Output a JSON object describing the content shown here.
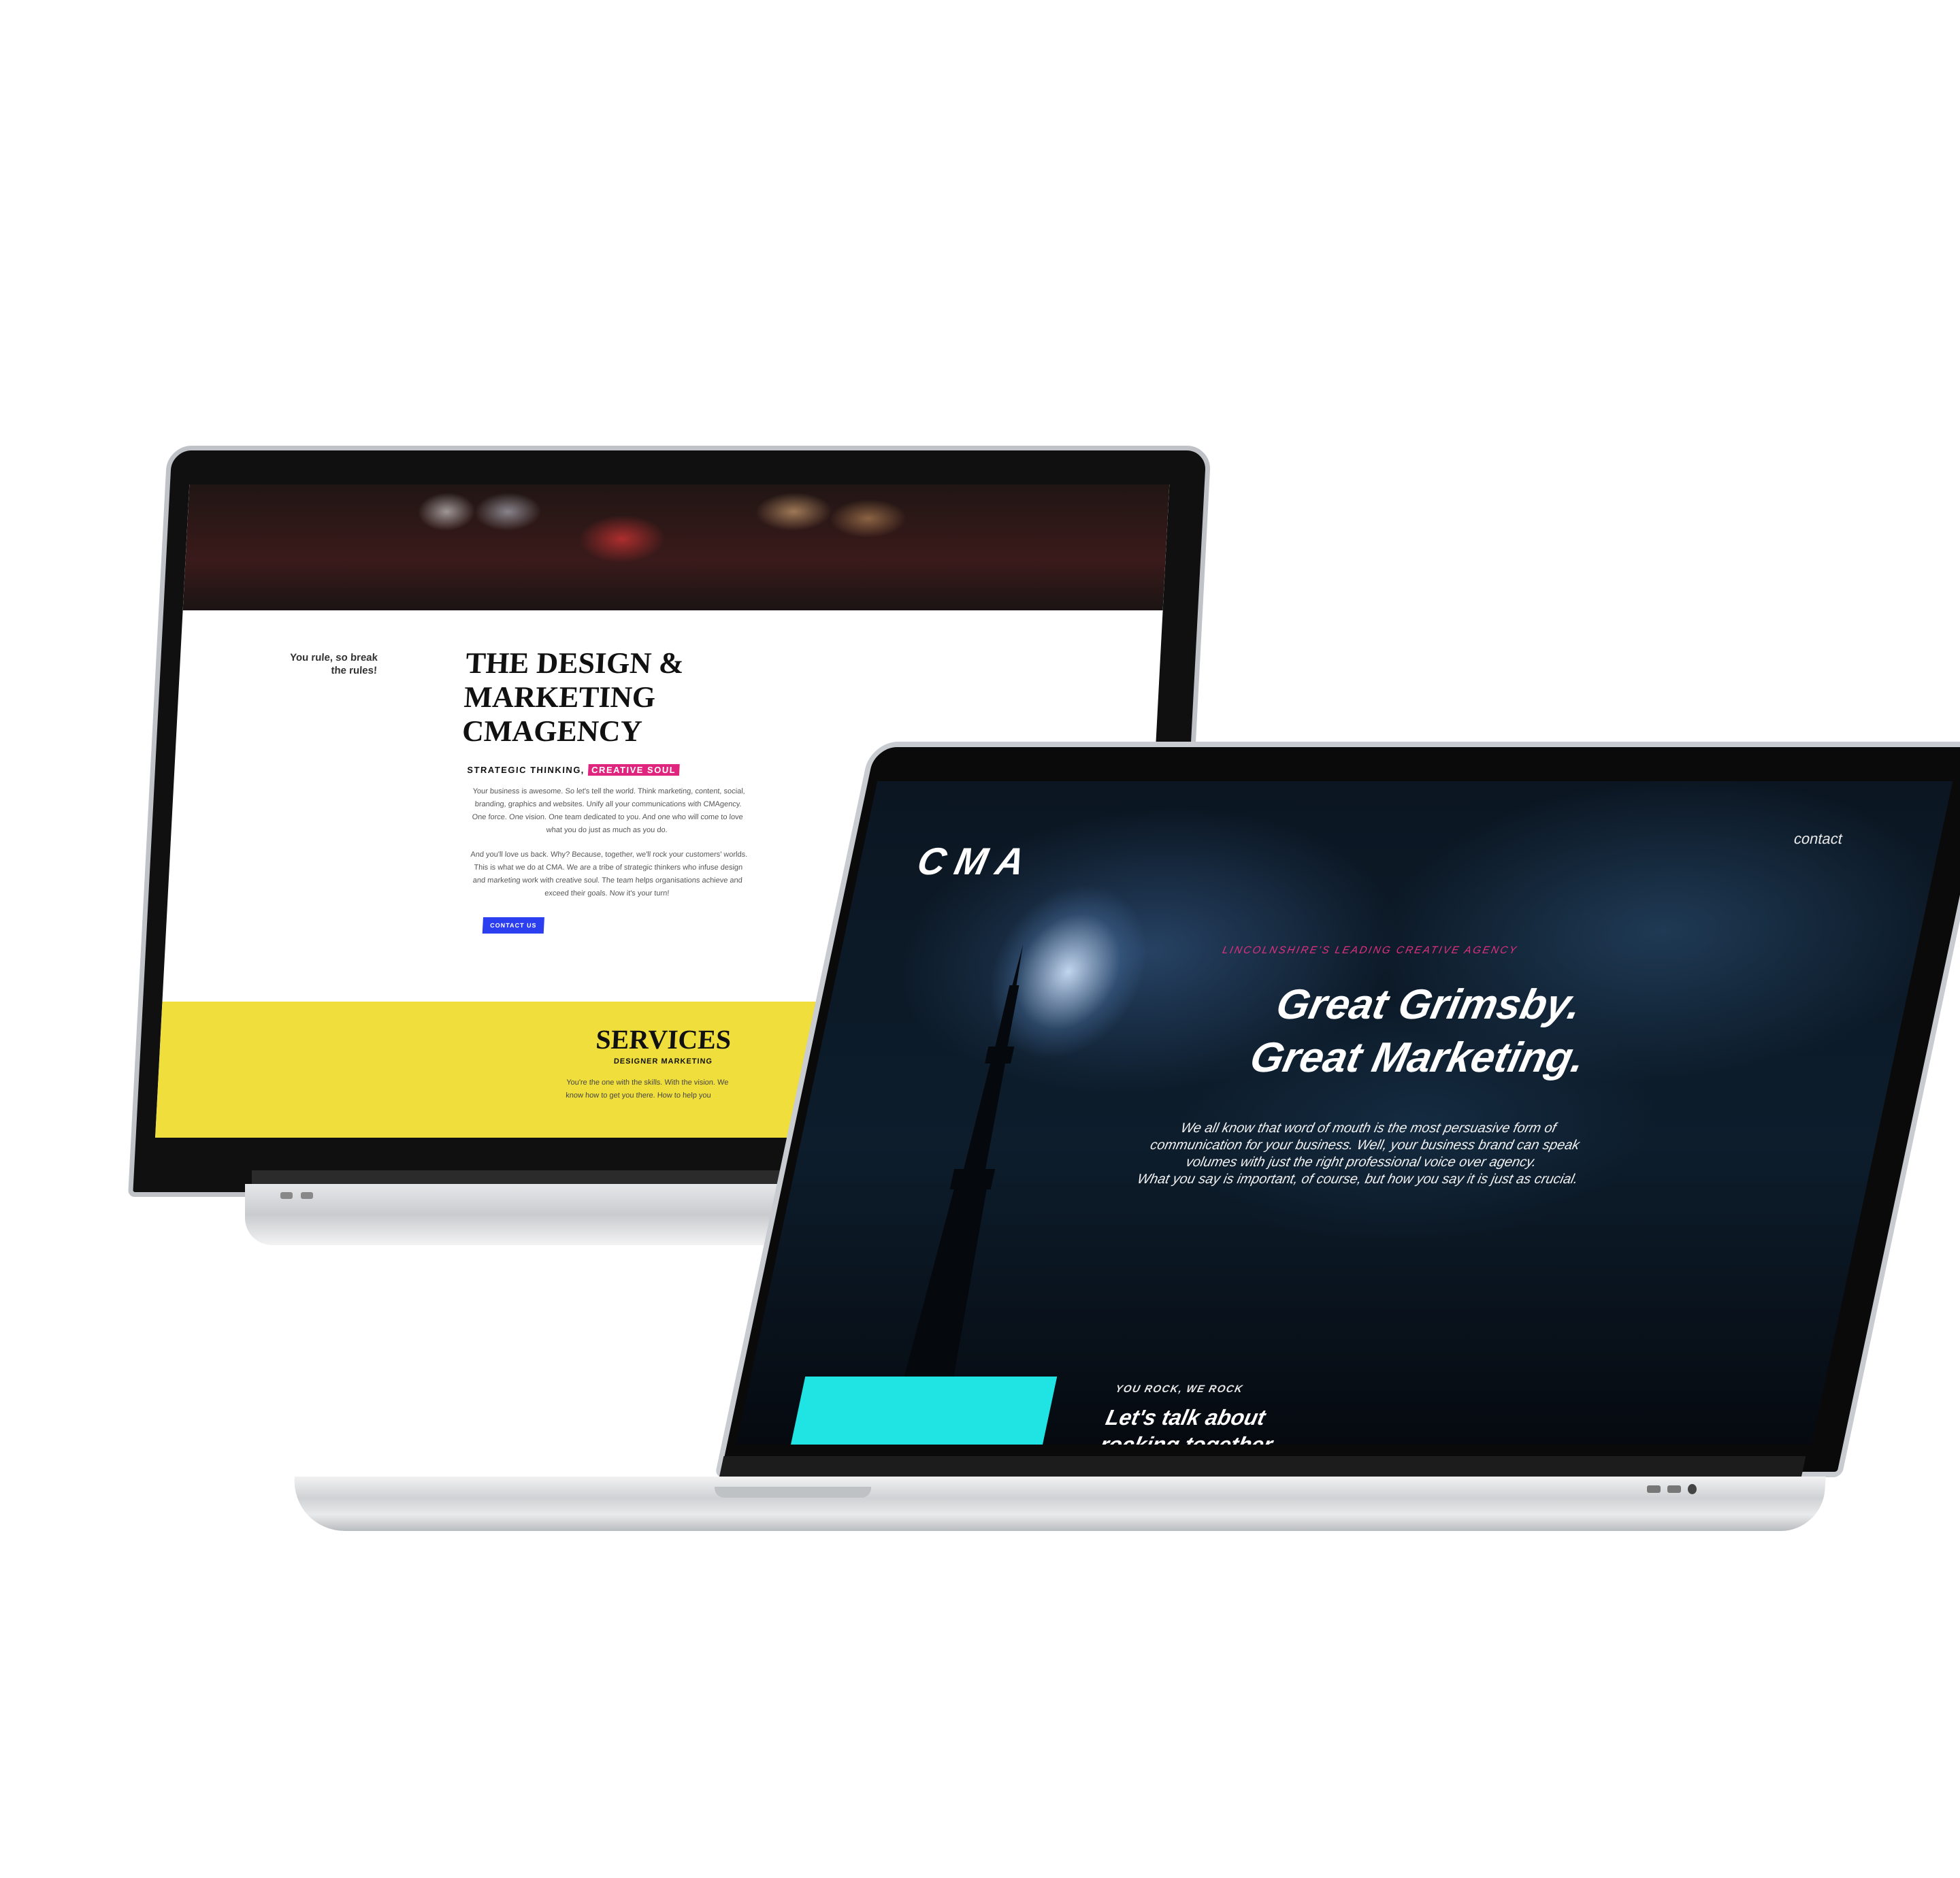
{
  "back_site": {
    "tagline": "You rule, so break the rules!",
    "headline": "The Design & Marketing CMAgency",
    "strategic_prefix": "STRATEGIC THINKING,",
    "strategic_highlight": "CREATIVE SOUL",
    "paragraph_1": "Your business is awesome. So let's tell the world. Think marketing, content, social, branding, graphics and websites. Unify all your communications with CMAgency. One force. One vision. One team dedicated to you. And one who will come to love what you do just as much as you do.",
    "paragraph_2": "And you'll love us back. Why? Because, together, we'll rock your customers' worlds. This is what we do at CMA. We are a tribe of strategic thinkers who infuse design and marketing work with creative soul. The team helps organisations achieve and exceed their goals. Now it's your turn!",
    "contact_button": "CONTACT US",
    "services_title": "SERVICES",
    "services_subtitle": "DESIGNER MARKETING",
    "services_text": "You're the one with the skills. With the vision. We know how to get you there. How to help you"
  },
  "front_site": {
    "logo": "CMA",
    "nav_contact": "contact",
    "eyebrow": "LINCOLNSHIRE'S LEADING CREATIVE AGENCY",
    "headline_line1": "Great Grimsby.",
    "headline_line2": "Great Marketing.",
    "body_line1": "We all know that word of mouth is the most persuasive form of",
    "body_line2": "communication for your business. Well, your business brand can speak",
    "body_line3": "volumes with just the right professional voice over agency.",
    "body_line4": "What you say is important, of course, but how you say it is just as crucial.",
    "rock_label": "YOU ROCK, WE ROCK",
    "rock_headline": "Let's talk about rocking together."
  },
  "colors": {
    "accent_pink": "#e0257f",
    "accent_blue": "#2b3ff0",
    "accent_yellow": "#f0de3c",
    "accent_cyan": "#20e3e3"
  }
}
